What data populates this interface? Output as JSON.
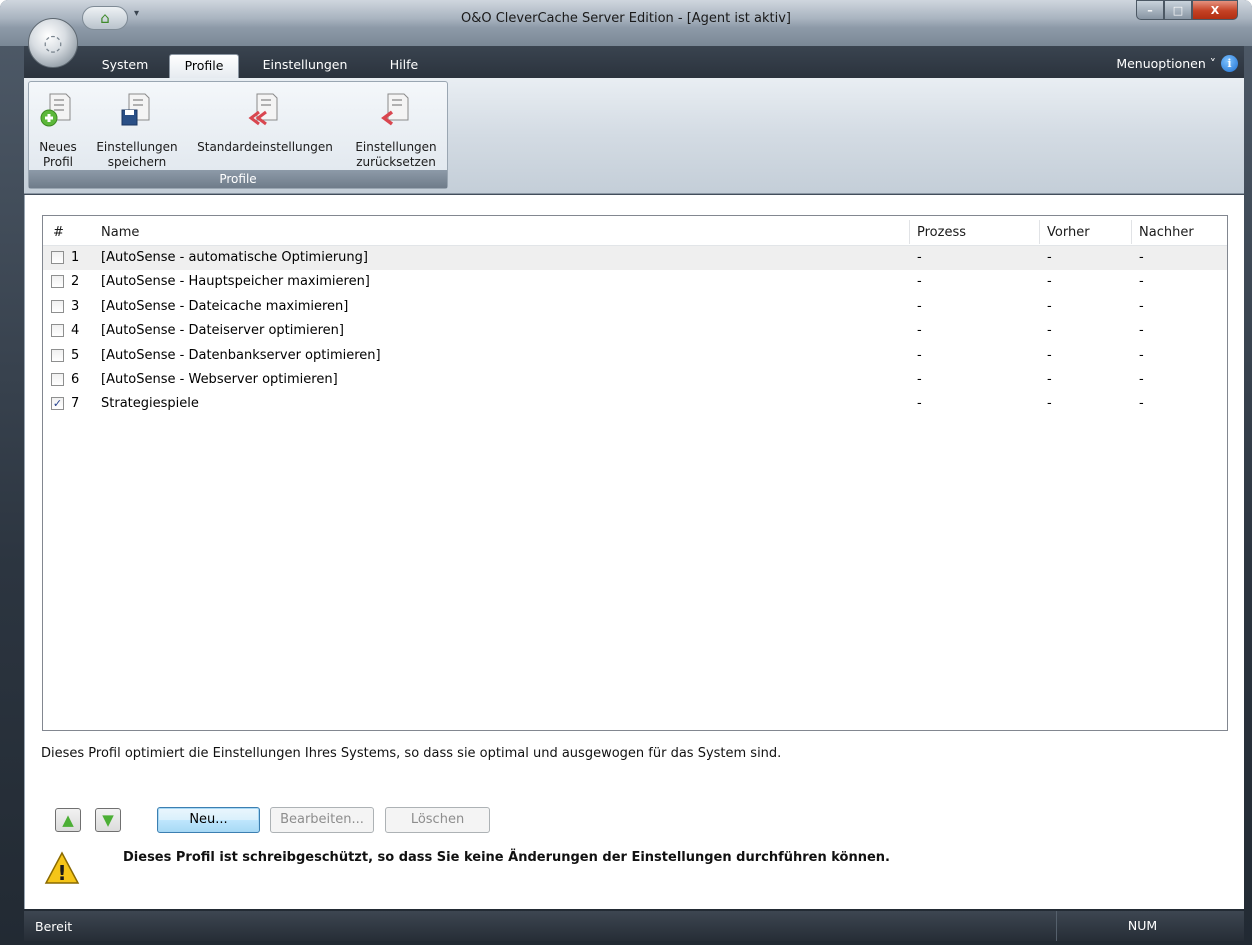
{
  "window": {
    "title": "O&O CleverCache Server Edition - [Agent ist aktiv]",
    "min_glyph": "–",
    "max_glyph": "□",
    "close_glyph": "X"
  },
  "quick_access": {
    "home_glyph": "⌂",
    "dropdown_glyph": "▾"
  },
  "ribbon_tabs": [
    {
      "label": "System",
      "active": false
    },
    {
      "label": "Profile",
      "active": true
    },
    {
      "label": "Einstellungen",
      "active": false
    },
    {
      "label": "Hilfe",
      "active": false
    }
  ],
  "menuoptionen": {
    "label": "Menuoptionen ˅",
    "info_glyph": "i"
  },
  "ribbon": {
    "group_label": "Profile",
    "buttons": [
      {
        "line1": "Neues",
        "line2": "Profil",
        "icon": "new-profile-icon"
      },
      {
        "line1": "Einstellungen",
        "line2": "speichern",
        "icon": "save-settings-icon"
      },
      {
        "line1": "Standardeinstellungen",
        "line2": "",
        "icon": "default-settings-icon"
      },
      {
        "line1": "Einstellungen",
        "line2": "zurücksetzen",
        "icon": "reset-settings-icon"
      }
    ]
  },
  "table": {
    "headers": {
      "num": "#",
      "name": "Name",
      "prozess": "Prozess",
      "vorher": "Vorher",
      "nachher": "Nachher"
    },
    "rows": [
      {
        "num": "1",
        "name": "[AutoSense - automatische Optimierung]",
        "prozess": "-",
        "vorher": "-",
        "nachher": "-",
        "checked": false,
        "selected": true
      },
      {
        "num": "2",
        "name": "[AutoSense - Hauptspeicher maximieren]",
        "prozess": "-",
        "vorher": "-",
        "nachher": "-",
        "checked": false,
        "selected": false
      },
      {
        "num": "3",
        "name": "[AutoSense - Dateicache maximieren]",
        "prozess": "-",
        "vorher": "-",
        "nachher": "-",
        "checked": false,
        "selected": false
      },
      {
        "num": "4",
        "name": "[AutoSense - Dateiserver optimieren]",
        "prozess": "-",
        "vorher": "-",
        "nachher": "-",
        "checked": false,
        "selected": false
      },
      {
        "num": "5",
        "name": "[AutoSense - Datenbankserver optimieren]",
        "prozess": "-",
        "vorher": "-",
        "nachher": "-",
        "checked": false,
        "selected": false
      },
      {
        "num": "6",
        "name": "[AutoSense - Webserver optimieren]",
        "prozess": "-",
        "vorher": "-",
        "nachher": "-",
        "checked": false,
        "selected": false
      },
      {
        "num": "7",
        "name": "Strategiespiele",
        "prozess": "-",
        "vorher": "-",
        "nachher": "-",
        "checked": true,
        "selected": false
      }
    ]
  },
  "description": "Dieses Profil optimiert die Einstellungen Ihres Systems, so dass sie optimal und ausgewogen für das System sind.",
  "buttons": {
    "up_glyph": "▲",
    "down_glyph": "▼",
    "new": "Neu...",
    "edit": "Bearbeiten...",
    "delete": "Löschen"
  },
  "warning": {
    "glyph": "!",
    "text": "Dieses Profil ist schreibgeschützt, so dass Sie keine Änderungen der Einstellungen durchführen können."
  },
  "status": {
    "left": "Bereit",
    "num": "NUM"
  },
  "colors": {
    "check": "#24408c",
    "arrow_green": "#4caf35",
    "warning_yellow": "#f5c518"
  }
}
